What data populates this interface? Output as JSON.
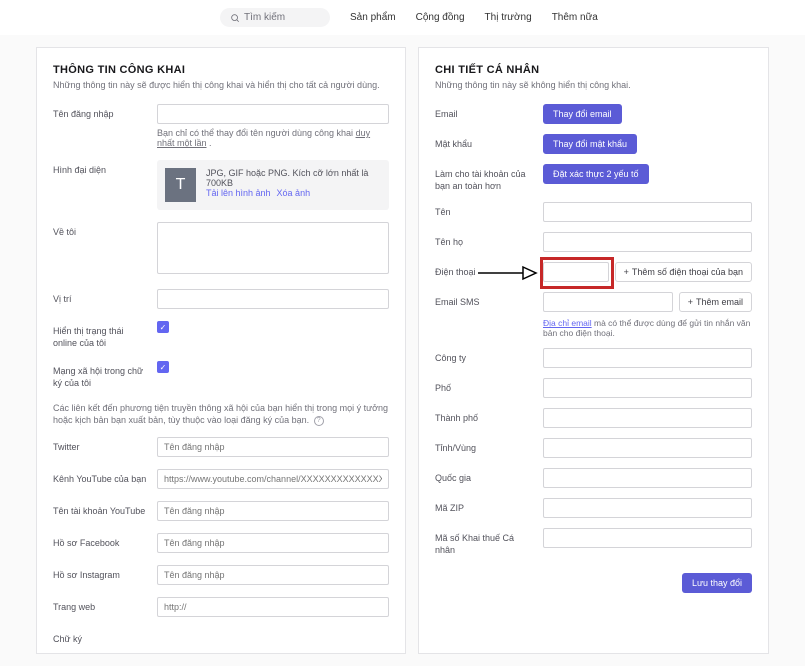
{
  "topbar": {
    "search_placeholder": "Tìm kiếm",
    "nav": [
      "Sản phẩm",
      "Cộng đồng",
      "Thị trường",
      "Thêm nữa"
    ]
  },
  "left": {
    "title": "THÔNG TIN CÔNG KHAI",
    "subtitle": "Những thông tin này sẽ được hiển thị công khai và hiển thị cho tất cả người dùng.",
    "username_label": "Tên đăng nhập",
    "username_hint_pre": "Bạn chỉ có thể thay đổi tên người dùng công khai ",
    "username_hint_u": "duy nhất một lần",
    "avatar_label": "Hình đại diện",
    "avatar_letter": "T",
    "avatar_desc": "JPG, GIF hoặc PNG. Kích cỡ lớn nhất là 700KB",
    "avatar_upload": "Tải lên hình ảnh",
    "avatar_remove": "Xóa ảnh",
    "about_label": "Về tôi",
    "location_label": "Vị trí",
    "show_online_label": "Hiển thị trạng thái online của tôi",
    "social_sig_label": "Mạng xã hội trong chữ ký của tôi",
    "links_note": "Các liên kết đến phương tiện truyền thông xã hội của bạn hiển thị trong mọi ý tưởng hoặc kịch bản bạn xuất bản, tùy thuộc vào loại đăng ký của bạn.",
    "twitter_label": "Twitter",
    "twitter_ph": "Tên đăng nhập",
    "youtube_ch_label": "Kênh YouTube của bạn",
    "youtube_ch_ph": "https://www.youtube.com/channel/XXXXXXXXXXXXXXXXXXXXXXXX",
    "youtube_user_label": "Tên tài khoản YouTube",
    "youtube_user_ph": "Tên đăng nhập",
    "facebook_label": "Hồ sơ Facebook",
    "facebook_ph": "Tên đăng nhập",
    "instagram_label": "Hồ sơ Instagram",
    "instagram_ph": "Tên đăng nhập",
    "website_label": "Trang web",
    "website_ph": "http://",
    "signature_label": "Chữ ký"
  },
  "right": {
    "title": "CHI TIẾT CÁ NHÂN",
    "subtitle": "Những thông tin này sẽ không hiển thị công khai.",
    "email_label": "Email",
    "email_btn": "Thay đổi email",
    "pwd_label": "Mật khẩu",
    "pwd_btn": "Thay đổi mật khẩu",
    "secure_label": "Làm cho tài khoản của bạn an toàn hơn",
    "secure_btn": "Đặt xác thực 2 yếu tố",
    "firstname_label": "Tên",
    "lastname_label": "Tên họ",
    "phone_label": "Điện thoại",
    "phone_btn": "Thêm số điện thoại của bạn",
    "sms_label": "Email SMS",
    "sms_btn": "Thêm email",
    "sms_hint_link": "Địa chỉ email",
    "sms_hint_rest": " mà có thể được dùng để gửi tin nhắn văn bản cho điện thoại.",
    "company_label": "Công ty",
    "street_label": "Phố",
    "city_label": "Thành phố",
    "state_label": "Tỉnh/Vùng",
    "country_label": "Quốc gia",
    "zip_label": "Mã ZIP",
    "tax_label": "Mã số Khai thuế Cá nhân",
    "save_btn": "Lưu thay đổi"
  }
}
